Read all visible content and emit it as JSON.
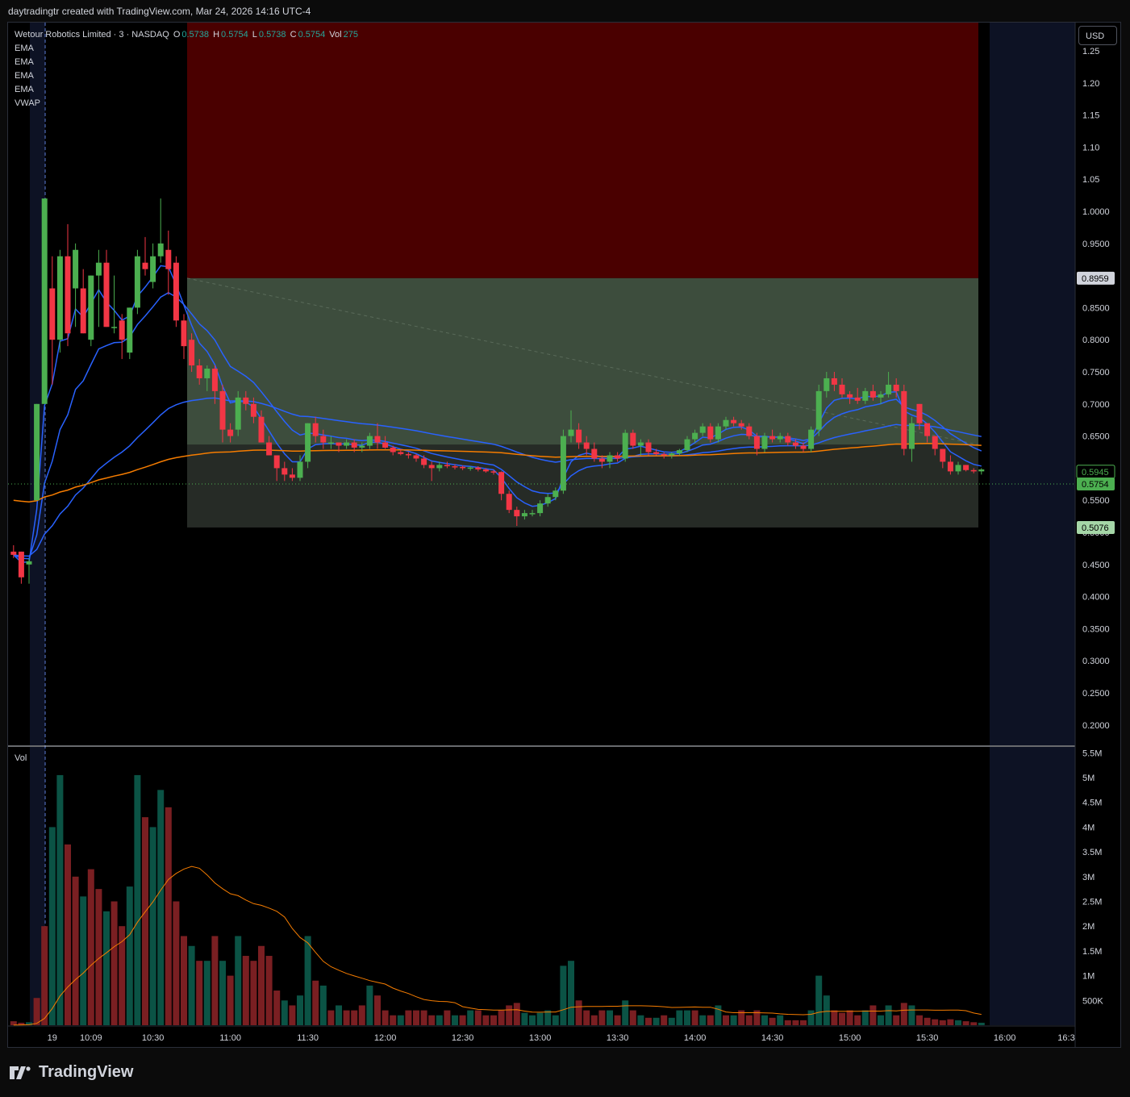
{
  "header": {
    "attribution": "daytradingtr created with TradingView.com, Mar 24, 2026 14:16 UTC-4"
  },
  "legend": {
    "symbol": "Wetour Robotics Limited · 3 · NASDAQ",
    "o_label": "O",
    "o": "0.5738",
    "h_label": "H",
    "h": "0.5754",
    "l_label": "L",
    "l": "0.5738",
    "c_label": "C",
    "c": "0.5754",
    "vol_label": "Vol",
    "vol": "275",
    "indicators": [
      "EMA",
      "EMA",
      "EMA",
      "EMA",
      "VWAP"
    ]
  },
  "toolbar": {
    "currency": "USD"
  },
  "volume_pane": {
    "label": "Vol"
  },
  "footer": {
    "brand": "TradingView"
  },
  "colors": {
    "up": "#26a69a",
    "up_candle": "#4caf50",
    "down": "#f23645",
    "up_vol": "#0b5345",
    "down_vol": "#7a1f22",
    "ema_blue": "#2962ff",
    "ema_orange": "#f57c00",
    "vol_ma": "#f57c00",
    "stop_zone": "#4a0000",
    "target_zone": "#3d4d3d",
    "entry_zone": "#262b26"
  },
  "chart_data": {
    "type": "candlestick",
    "price_axis": {
      "ticks": [
        "1.25",
        "1.20",
        "1.15",
        "1.10",
        "1.05",
        "1.0000",
        "0.9500",
        "0.9000",
        "0.8500",
        "0.8000",
        "0.7500",
        "0.7000",
        "0.6500",
        "0.6000",
        "0.5500",
        "0.5000",
        "0.4500",
        "0.4000",
        "0.3500",
        "0.3000",
        "0.2500",
        "0.2000"
      ],
      "ylim": [
        0.17,
        1.28
      ]
    },
    "volume_axis": {
      "ticks": [
        "5.5M",
        "5M",
        "4.5M",
        "4M",
        "3.5M",
        "3M",
        "2.5M",
        "2M",
        "1.5M",
        "1M",
        "500K"
      ],
      "ylim": [
        0,
        5.55
      ]
    },
    "time_axis": {
      "ticks": [
        "19",
        "10:09",
        "10:30",
        "11:00",
        "11:30",
        "12:00",
        "12:30",
        "13:00",
        "13:30",
        "14:00",
        "14:30",
        "15:00",
        "15:30",
        "16:00",
        "16:3"
      ]
    },
    "price_labels": [
      {
        "value": 0.8959,
        "text": "0.8959",
        "style": "neutral"
      },
      {
        "value": 0.5945,
        "text": "0.5945",
        "style": "outline"
      },
      {
        "value": 0.5754,
        "text": "0.5754",
        "style": "filled"
      },
      {
        "value": 0.5076,
        "text": "0.5076",
        "style": "light"
      }
    ],
    "position_tool": {
      "stop": 1.28,
      "entry": 0.6365,
      "target_top": 0.8959,
      "target_low": 0.5076
    },
    "last_price": 0.5754,
    "candles": [
      [
        0.47,
        0.48,
        0.46,
        0.465
      ],
      [
        0.47,
        0.47,
        0.42,
        0.43
      ],
      [
        0.45,
        0.46,
        0.42,
        0.455
      ],
      [
        0.55,
        0.7,
        0.55,
        0.7
      ],
      [
        0.7,
        1.02,
        0.7,
        1.02
      ],
      [
        0.88,
        0.93,
        0.73,
        0.8
      ],
      [
        0.8,
        0.94,
        0.78,
        0.93
      ],
      [
        0.93,
        0.98,
        0.79,
        0.81
      ],
      [
        0.88,
        0.95,
        0.82,
        0.94
      ],
      [
        0.88,
        0.91,
        0.81,
        0.81
      ],
      [
        0.8,
        0.9,
        0.79,
        0.9
      ],
      [
        0.9,
        0.94,
        0.82,
        0.92
      ],
      [
        0.92,
        0.94,
        0.82,
        0.82
      ],
      [
        0.82,
        0.9,
        0.81,
        0.82
      ],
      [
        0.83,
        0.84,
        0.77,
        0.8
      ],
      [
        0.78,
        0.85,
        0.77,
        0.85
      ],
      [
        0.85,
        0.94,
        0.84,
        0.93
      ],
      [
        0.92,
        0.96,
        0.9,
        0.91
      ],
      [
        0.89,
        0.95,
        0.88,
        0.93
      ],
      [
        0.93,
        1.02,
        0.92,
        0.95
      ],
      [
        0.94,
        0.97,
        0.87,
        0.91
      ],
      [
        0.92,
        0.93,
        0.82,
        0.83
      ],
      [
        0.83,
        0.84,
        0.77,
        0.79
      ],
      [
        0.8,
        0.81,
        0.75,
        0.76
      ],
      [
        0.76,
        0.77,
        0.73,
        0.74
      ],
      [
        0.74,
        0.76,
        0.72,
        0.755
      ],
      [
        0.755,
        0.76,
        0.7,
        0.72
      ],
      [
        0.72,
        0.73,
        0.64,
        0.66
      ],
      [
        0.66,
        0.67,
        0.64,
        0.65
      ],
      [
        0.66,
        0.72,
        0.65,
        0.71
      ],
      [
        0.71,
        0.72,
        0.69,
        0.7
      ],
      [
        0.7,
        0.71,
        0.67,
        0.68
      ],
      [
        0.68,
        0.69,
        0.64,
        0.64
      ],
      [
        0.64,
        0.65,
        0.62,
        0.62
      ],
      [
        0.62,
        0.62,
        0.58,
        0.6
      ],
      [
        0.6,
        0.61,
        0.58,
        0.59
      ],
      [
        0.59,
        0.6,
        0.58,
        0.585
      ],
      [
        0.585,
        0.62,
        0.58,
        0.61
      ],
      [
        0.61,
        0.67,
        0.6,
        0.67
      ],
      [
        0.67,
        0.68,
        0.64,
        0.65
      ],
      [
        0.65,
        0.66,
        0.63,
        0.64
      ],
      [
        0.64,
        0.65,
        0.63,
        0.64
      ],
      [
        0.64,
        0.64,
        0.625,
        0.635
      ],
      [
        0.635,
        0.645,
        0.63,
        0.64
      ],
      [
        0.64,
        0.645,
        0.625,
        0.632
      ],
      [
        0.632,
        0.64,
        0.625,
        0.635
      ],
      [
        0.635,
        0.655,
        0.63,
        0.65
      ],
      [
        0.65,
        0.67,
        0.63,
        0.64
      ],
      [
        0.64,
        0.65,
        0.63,
        0.632
      ],
      [
        0.632,
        0.635,
        0.62,
        0.625
      ],
      [
        0.625,
        0.63,
        0.62,
        0.622
      ],
      [
        0.622,
        0.625,
        0.615,
        0.62
      ],
      [
        0.62,
        0.622,
        0.61,
        0.615
      ],
      [
        0.615,
        0.62,
        0.6,
        0.605
      ],
      [
        0.605,
        0.61,
        0.58,
        0.6
      ],
      [
        0.6,
        0.61,
        0.595,
        0.605
      ],
      [
        0.605,
        0.61,
        0.6,
        0.603
      ],
      [
        0.603,
        0.606,
        0.598,
        0.602
      ],
      [
        0.602,
        0.604,
        0.597,
        0.6
      ],
      [
        0.6,
        0.603,
        0.596,
        0.601
      ],
      [
        0.601,
        0.603,
        0.595,
        0.598
      ],
      [
        0.598,
        0.6,
        0.593,
        0.595
      ],
      [
        0.595,
        0.597,
        0.59,
        0.594
      ],
      [
        0.594,
        0.595,
        0.55,
        0.56
      ],
      [
        0.56,
        0.565,
        0.53,
        0.535
      ],
      [
        0.535,
        0.54,
        0.51,
        0.525
      ],
      [
        0.525,
        0.535,
        0.52,
        0.53
      ],
      [
        0.53,
        0.535,
        0.525,
        0.53
      ],
      [
        0.53,
        0.55,
        0.525,
        0.545
      ],
      [
        0.545,
        0.56,
        0.54,
        0.555
      ],
      [
        0.555,
        0.57,
        0.55,
        0.565
      ],
      [
        0.565,
        0.66,
        0.56,
        0.65
      ],
      [
        0.65,
        0.69,
        0.64,
        0.66
      ],
      [
        0.66,
        0.67,
        0.63,
        0.64
      ],
      [
        0.64,
        0.65,
        0.62,
        0.63
      ],
      [
        0.63,
        0.64,
        0.61,
        0.615
      ],
      [
        0.615,
        0.62,
        0.6,
        0.61
      ],
      [
        0.61,
        0.625,
        0.6,
        0.62
      ],
      [
        0.62,
        0.625,
        0.61,
        0.615
      ],
      [
        0.615,
        0.66,
        0.61,
        0.655
      ],
      [
        0.655,
        0.66,
        0.63,
        0.635
      ],
      [
        0.635,
        0.645,
        0.62,
        0.64
      ],
      [
        0.64,
        0.645,
        0.62,
        0.625
      ],
      [
        0.625,
        0.63,
        0.62,
        0.622
      ],
      [
        0.622,
        0.625,
        0.615,
        0.62
      ],
      [
        0.62,
        0.625,
        0.615,
        0.623
      ],
      [
        0.623,
        0.63,
        0.62,
        0.628
      ],
      [
        0.628,
        0.65,
        0.625,
        0.645
      ],
      [
        0.645,
        0.66,
        0.64,
        0.655
      ],
      [
        0.655,
        0.67,
        0.65,
        0.665
      ],
      [
        0.665,
        0.67,
        0.64,
        0.645
      ],
      [
        0.645,
        0.67,
        0.64,
        0.665
      ],
      [
        0.665,
        0.68,
        0.66,
        0.675
      ],
      [
        0.675,
        0.68,
        0.665,
        0.67
      ],
      [
        0.67,
        0.675,
        0.66,
        0.665
      ],
      [
        0.665,
        0.67,
        0.645,
        0.65
      ],
      [
        0.65,
        0.655,
        0.62,
        0.63
      ],
      [
        0.63,
        0.655,
        0.625,
        0.65
      ],
      [
        0.65,
        0.66,
        0.64,
        0.645
      ],
      [
        0.645,
        0.655,
        0.64,
        0.65
      ],
      [
        0.65,
        0.655,
        0.635,
        0.64
      ],
      [
        0.64,
        0.645,
        0.63,
        0.635
      ],
      [
        0.635,
        0.64,
        0.625,
        0.63
      ],
      [
        0.63,
        0.665,
        0.625,
        0.66
      ],
      [
        0.66,
        0.73,
        0.65,
        0.72
      ],
      [
        0.72,
        0.75,
        0.71,
        0.74
      ],
      [
        0.74,
        0.75,
        0.72,
        0.73
      ],
      [
        0.73,
        0.74,
        0.71,
        0.715
      ],
      [
        0.715,
        0.72,
        0.7,
        0.71
      ],
      [
        0.71,
        0.725,
        0.7,
        0.705
      ],
      [
        0.705,
        0.725,
        0.7,
        0.72
      ],
      [
        0.72,
        0.73,
        0.705,
        0.71
      ],
      [
        0.71,
        0.72,
        0.7,
        0.715
      ],
      [
        0.715,
        0.75,
        0.71,
        0.73
      ],
      [
        0.73,
        0.74,
        0.71,
        0.72
      ],
      [
        0.72,
        0.73,
        0.62,
        0.63
      ],
      [
        0.63,
        0.68,
        0.61,
        0.67
      ],
      [
        0.7,
        0.7,
        0.66,
        0.67
      ],
      [
        0.67,
        0.67,
        0.64,
        0.65
      ],
      [
        0.65,
        0.65,
        0.62,
        0.63
      ],
      [
        0.63,
        0.63,
        0.6,
        0.61
      ],
      [
        0.61,
        0.62,
        0.59,
        0.595
      ],
      [
        0.595,
        0.61,
        0.59,
        0.605
      ],
      [
        0.605,
        0.605,
        0.595,
        0.597
      ],
      [
        0.597,
        0.6,
        0.592,
        0.595
      ],
      [
        0.595,
        0.6,
        0.59,
        0.598
      ]
    ],
    "volume": [
      [
        0.08,
        "dn"
      ],
      [
        0.05,
        "dn"
      ],
      [
        0.06,
        "up"
      ],
      [
        0.55,
        "dn"
      ],
      [
        2.0,
        "dn"
      ],
      [
        4.0,
        "up"
      ],
      [
        5.05,
        "up"
      ],
      [
        3.65,
        "dn"
      ],
      [
        3.0,
        "dn"
      ],
      [
        2.6,
        "up"
      ],
      [
        3.15,
        "dn"
      ],
      [
        2.75,
        "dn"
      ],
      [
        2.3,
        "up"
      ],
      [
        2.5,
        "dn"
      ],
      [
        2.0,
        "dn"
      ],
      [
        2.8,
        "up"
      ],
      [
        5.05,
        "up"
      ],
      [
        4.2,
        "dn"
      ],
      [
        4.0,
        "up"
      ],
      [
        4.75,
        "up"
      ],
      [
        4.4,
        "dn"
      ],
      [
        2.5,
        "dn"
      ],
      [
        1.8,
        "dn"
      ],
      [
        1.6,
        "up"
      ],
      [
        1.3,
        "dn"
      ],
      [
        1.3,
        "up"
      ],
      [
        1.8,
        "dn"
      ],
      [
        1.3,
        "up"
      ],
      [
        1.0,
        "dn"
      ],
      [
        1.8,
        "up"
      ],
      [
        1.4,
        "dn"
      ],
      [
        1.3,
        "dn"
      ],
      [
        1.6,
        "dn"
      ],
      [
        1.4,
        "dn"
      ],
      [
        0.7,
        "dn"
      ],
      [
        0.5,
        "up"
      ],
      [
        0.4,
        "dn"
      ],
      [
        0.6,
        "up"
      ],
      [
        1.8,
        "up"
      ],
      [
        0.9,
        "dn"
      ],
      [
        0.8,
        "up"
      ],
      [
        0.3,
        "dn"
      ],
      [
        0.4,
        "up"
      ],
      [
        0.3,
        "dn"
      ],
      [
        0.3,
        "dn"
      ],
      [
        0.4,
        "dn"
      ],
      [
        0.8,
        "up"
      ],
      [
        0.6,
        "dn"
      ],
      [
        0.3,
        "dn"
      ],
      [
        0.2,
        "dn"
      ],
      [
        0.2,
        "up"
      ],
      [
        0.3,
        "dn"
      ],
      [
        0.3,
        "dn"
      ],
      [
        0.3,
        "dn"
      ],
      [
        0.2,
        "dn"
      ],
      [
        0.2,
        "up"
      ],
      [
        0.3,
        "dn"
      ],
      [
        0.2,
        "up"
      ],
      [
        0.2,
        "dn"
      ],
      [
        0.3,
        "up"
      ],
      [
        0.3,
        "dn"
      ],
      [
        0.2,
        "dn"
      ],
      [
        0.2,
        "dn"
      ],
      [
        0.3,
        "dn"
      ],
      [
        0.4,
        "dn"
      ],
      [
        0.45,
        "dn"
      ],
      [
        0.25,
        "up"
      ],
      [
        0.2,
        "up"
      ],
      [
        0.25,
        "up"
      ],
      [
        0.3,
        "up"
      ],
      [
        0.2,
        "up"
      ],
      [
        1.2,
        "up"
      ],
      [
        1.3,
        "up"
      ],
      [
        0.5,
        "dn"
      ],
      [
        0.3,
        "dn"
      ],
      [
        0.2,
        "dn"
      ],
      [
        0.3,
        "dn"
      ],
      [
        0.3,
        "up"
      ],
      [
        0.2,
        "dn"
      ],
      [
        0.5,
        "up"
      ],
      [
        0.3,
        "dn"
      ],
      [
        0.2,
        "up"
      ],
      [
        0.15,
        "dn"
      ],
      [
        0.15,
        "up"
      ],
      [
        0.2,
        "dn"
      ],
      [
        0.15,
        "up"
      ],
      [
        0.3,
        "up"
      ],
      [
        0.3,
        "up"
      ],
      [
        0.3,
        "dn"
      ],
      [
        0.2,
        "up"
      ],
      [
        0.2,
        "dn"
      ],
      [
        0.4,
        "up"
      ],
      [
        0.2,
        "dn"
      ],
      [
        0.2,
        "up"
      ],
      [
        0.3,
        "dn"
      ],
      [
        0.2,
        "dn"
      ],
      [
        0.3,
        "dn"
      ],
      [
        0.2,
        "up"
      ],
      [
        0.15,
        "dn"
      ],
      [
        0.2,
        "up"
      ],
      [
        0.1,
        "dn"
      ],
      [
        0.1,
        "dn"
      ],
      [
        0.1,
        "dn"
      ],
      [
        0.3,
        "up"
      ],
      [
        1.0,
        "up"
      ],
      [
        0.6,
        "up"
      ],
      [
        0.3,
        "dn"
      ],
      [
        0.25,
        "dn"
      ],
      [
        0.3,
        "dn"
      ],
      [
        0.2,
        "dn"
      ],
      [
        0.3,
        "up"
      ],
      [
        0.4,
        "dn"
      ],
      [
        0.2,
        "up"
      ],
      [
        0.4,
        "up"
      ],
      [
        0.2,
        "dn"
      ],
      [
        0.45,
        "dn"
      ],
      [
        0.4,
        "up"
      ],
      [
        0.2,
        "dn"
      ],
      [
        0.15,
        "dn"
      ],
      [
        0.12,
        "dn"
      ],
      [
        0.1,
        "dn"
      ],
      [
        0.12,
        "dn"
      ],
      [
        0.1,
        "up"
      ],
      [
        0.08,
        "dn"
      ],
      [
        0.06,
        "dn"
      ],
      [
        0.05,
        "up"
      ]
    ]
  }
}
